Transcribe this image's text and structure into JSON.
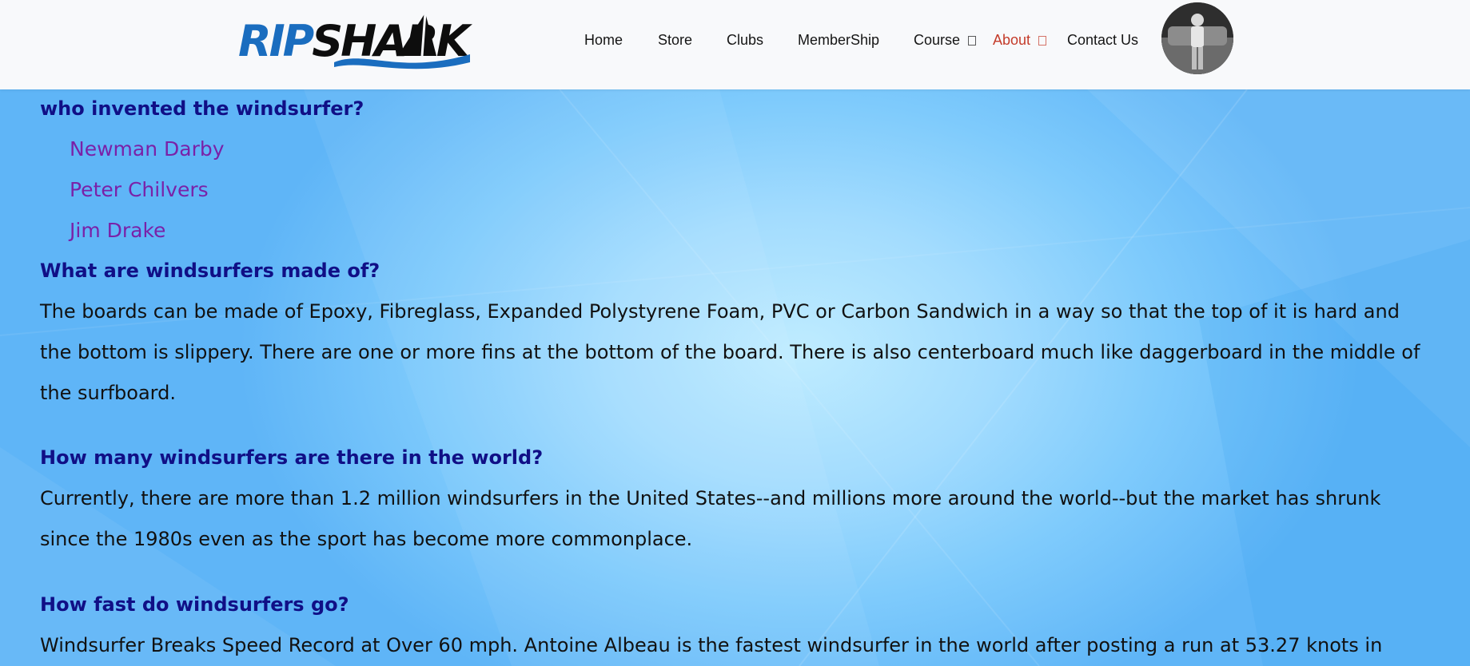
{
  "header": {
    "logo": {
      "part1": "RIP",
      "part2": "SHARK",
      "color_primary": "#1a6dbf",
      "color_secondary": "#0d0d0d"
    },
    "nav": [
      {
        "label": "Home"
      },
      {
        "label": "Store"
      },
      {
        "label": "Clubs"
      },
      {
        "label": "MemberShip"
      },
      {
        "label": "Course"
      },
      {
        "label": "About"
      },
      {
        "label": "Contact Us"
      }
    ],
    "active_nav_color": "#c43b2a",
    "avatar": {
      "icon": "user-avatar"
    }
  },
  "faq": {
    "q1": {
      "question": "who invented the windsurfer?",
      "links": [
        "Newman Darby",
        "Peter Chilvers",
        "Jim Drake"
      ]
    },
    "q2": {
      "question": "What are windsurfers made of?",
      "answer": "The boards can be made of Epoxy, Fibreglass, Expanded Polystyrene Foam, PVC or Carbon Sandwich in a way so that the top of it is hard and the bottom is slippery. There are one or more fins at the bottom of the board. There is also centerboard much like daggerboard in the middle of the surfboard."
    },
    "q3": {
      "question": "How many windsurfers are there in the world?",
      "answer": "Currently, there are more than 1.2 million windsurfers in the United States--and millions more around the world--but the market has shrunk since the 1980s even as the sport has become more commonplace."
    },
    "q4": {
      "question": "How fast do windsurfers go?",
      "answer": "Windsurfer Breaks Speed Record at Over 60 mph. Antoine Albeau is the fastest windsurfer in the world after posting a run at 53.27 knots in"
    }
  },
  "colors": {
    "heading": "#100f86",
    "link": "#7a21a8",
    "text": "#111111",
    "background": "#7fcbfc"
  }
}
